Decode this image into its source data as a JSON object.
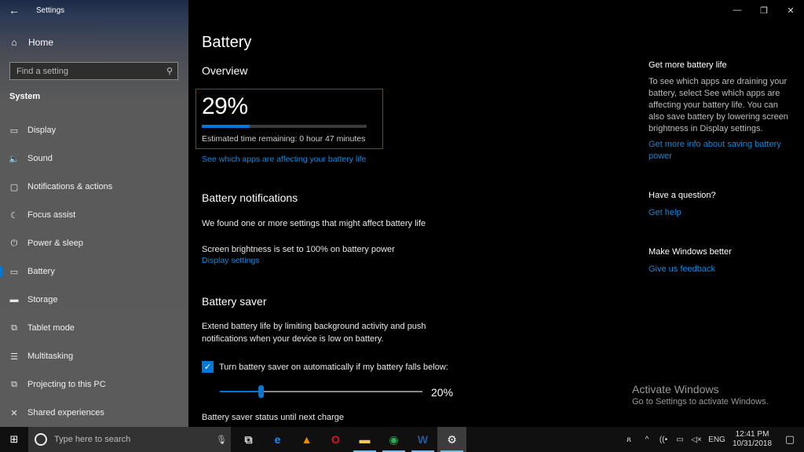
{
  "window": {
    "app_title": "Settings",
    "controls": {
      "minimize": "—",
      "maximize": "❐",
      "close": "✕"
    }
  },
  "sidebar": {
    "home_label": "Home",
    "search_placeholder": "Find a setting",
    "section_label": "System",
    "items": [
      {
        "label": "Display",
        "icon": "display-icon",
        "glyph": "▭",
        "active": false
      },
      {
        "label": "Sound",
        "icon": "sound-icon",
        "glyph": "🔈",
        "active": false
      },
      {
        "label": "Notifications & actions",
        "icon": "notifications-icon",
        "glyph": "▢",
        "active": false
      },
      {
        "label": "Focus assist",
        "icon": "moon-icon",
        "glyph": "☾",
        "active": false
      },
      {
        "label": "Power & sleep",
        "icon": "power-icon",
        "glyph": "⏻",
        "active": false
      },
      {
        "label": "Battery",
        "icon": "battery-icon",
        "glyph": "▭",
        "active": true
      },
      {
        "label": "Storage",
        "icon": "storage-icon",
        "glyph": "▬",
        "active": false
      },
      {
        "label": "Tablet mode",
        "icon": "tablet-mode-icon",
        "glyph": "⧉",
        "active": false
      },
      {
        "label": "Multitasking",
        "icon": "multitasking-icon",
        "glyph": "☰",
        "active": false
      },
      {
        "label": "Projecting to this PC",
        "icon": "projecting-icon",
        "glyph": "⧉",
        "active": false
      },
      {
        "label": "Shared experiences",
        "icon": "shared-experiences-icon",
        "glyph": "✕",
        "active": false
      }
    ]
  },
  "main": {
    "title": "Battery",
    "overview": {
      "heading": "Overview",
      "percent_label": "29%",
      "percent_value": 29,
      "estimate": "Estimated time remaining: 0 hour 47 minutes",
      "apps_link": "See which apps are affecting your battery life"
    },
    "notifications": {
      "heading": "Battery notifications",
      "found_text": "We found one or more settings that might affect battery life",
      "brightness_text": "Screen brightness is set to 100% on battery power",
      "display_link": "Display settings"
    },
    "saver": {
      "heading": "Battery saver",
      "description_line1": "Extend battery life by limiting background activity and push",
      "description_line2": "notifications when your device is low on battery.",
      "auto_checkbox_label": "Turn battery saver on automatically if my battery falls below:",
      "auto_checked": true,
      "threshold_percent": 20,
      "threshold_label": "20%",
      "status_label": "Battery saver status until next charge"
    }
  },
  "right_panel": {
    "more_life_heading": "Get more battery life",
    "more_life_text": "To see which apps are draining your battery, select See which apps are affecting your battery life. You can also save battery by lowering screen brightness in Display settings.",
    "more_info_link": "Get more info about saving battery power",
    "question_heading": "Have a question?",
    "help_link": "Get help",
    "better_heading": "Make Windows better",
    "feedback_link": "Give us feedback"
  },
  "watermark": {
    "title": "Activate Windows",
    "subtitle": "Go to Settings to activate Windows."
  },
  "taskbar": {
    "search_placeholder": "Type here to search",
    "apps": [
      {
        "name": "task-view",
        "glyph": "⧉",
        "color": "#dddddd",
        "running": false,
        "active": false
      },
      {
        "name": "edge",
        "glyph": "e",
        "color": "#1a8cff",
        "running": false,
        "active": false
      },
      {
        "name": "vlc",
        "glyph": "▲",
        "color": "#f08a00",
        "running": false,
        "active": false
      },
      {
        "name": "opera",
        "glyph": "O",
        "color": "#e0141e",
        "running": false,
        "active": false
      },
      {
        "name": "file-explorer",
        "glyph": "▬",
        "color": "#f2c94c",
        "running": true,
        "active": false
      },
      {
        "name": "chrome",
        "glyph": "◉",
        "color": "#34a853",
        "running": true,
        "active": false
      },
      {
        "name": "word",
        "glyph": "W",
        "color": "#2b5797",
        "running": true,
        "active": false
      },
      {
        "name": "settings",
        "glyph": "⚙",
        "color": "#ffffff",
        "running": true,
        "active": true
      }
    ],
    "tray": {
      "people": "ጸ",
      "chevron": "^",
      "wifi": "((•",
      "battery": "▭",
      "volume": "◁×",
      "language": "ENG",
      "time": "12:41 PM",
      "date": "10/31/2018",
      "action_center": "▢"
    }
  }
}
